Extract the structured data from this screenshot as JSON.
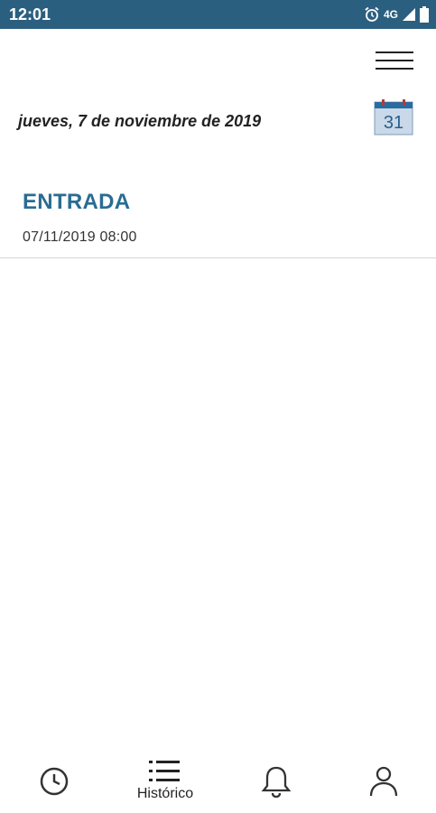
{
  "status_bar": {
    "time": "12:01",
    "network": "4G",
    "icons": [
      "alarm-icon",
      "signal-icon",
      "battery-icon"
    ]
  },
  "header": {
    "menu_icon": "hamburger-menu-icon"
  },
  "date_selector": {
    "date_text": "jueves, 7 de noviembre de 2019",
    "calendar_day": "31",
    "calendar_icon": "calendar-icon"
  },
  "entries": [
    {
      "type": "ENTRADA",
      "datetime": "07/11/2019 08:00"
    }
  ],
  "bottom_nav": {
    "items": [
      {
        "icon": "clock-icon",
        "label": ""
      },
      {
        "icon": "list-icon",
        "label": "Histórico"
      },
      {
        "icon": "bell-icon",
        "label": ""
      },
      {
        "icon": "user-icon",
        "label": ""
      }
    ],
    "active_index": 1
  },
  "colors": {
    "status_bar": "#2b5f7f",
    "accent": "#2a6c92",
    "text": "#222222",
    "divider": "#d6d6d6"
  }
}
